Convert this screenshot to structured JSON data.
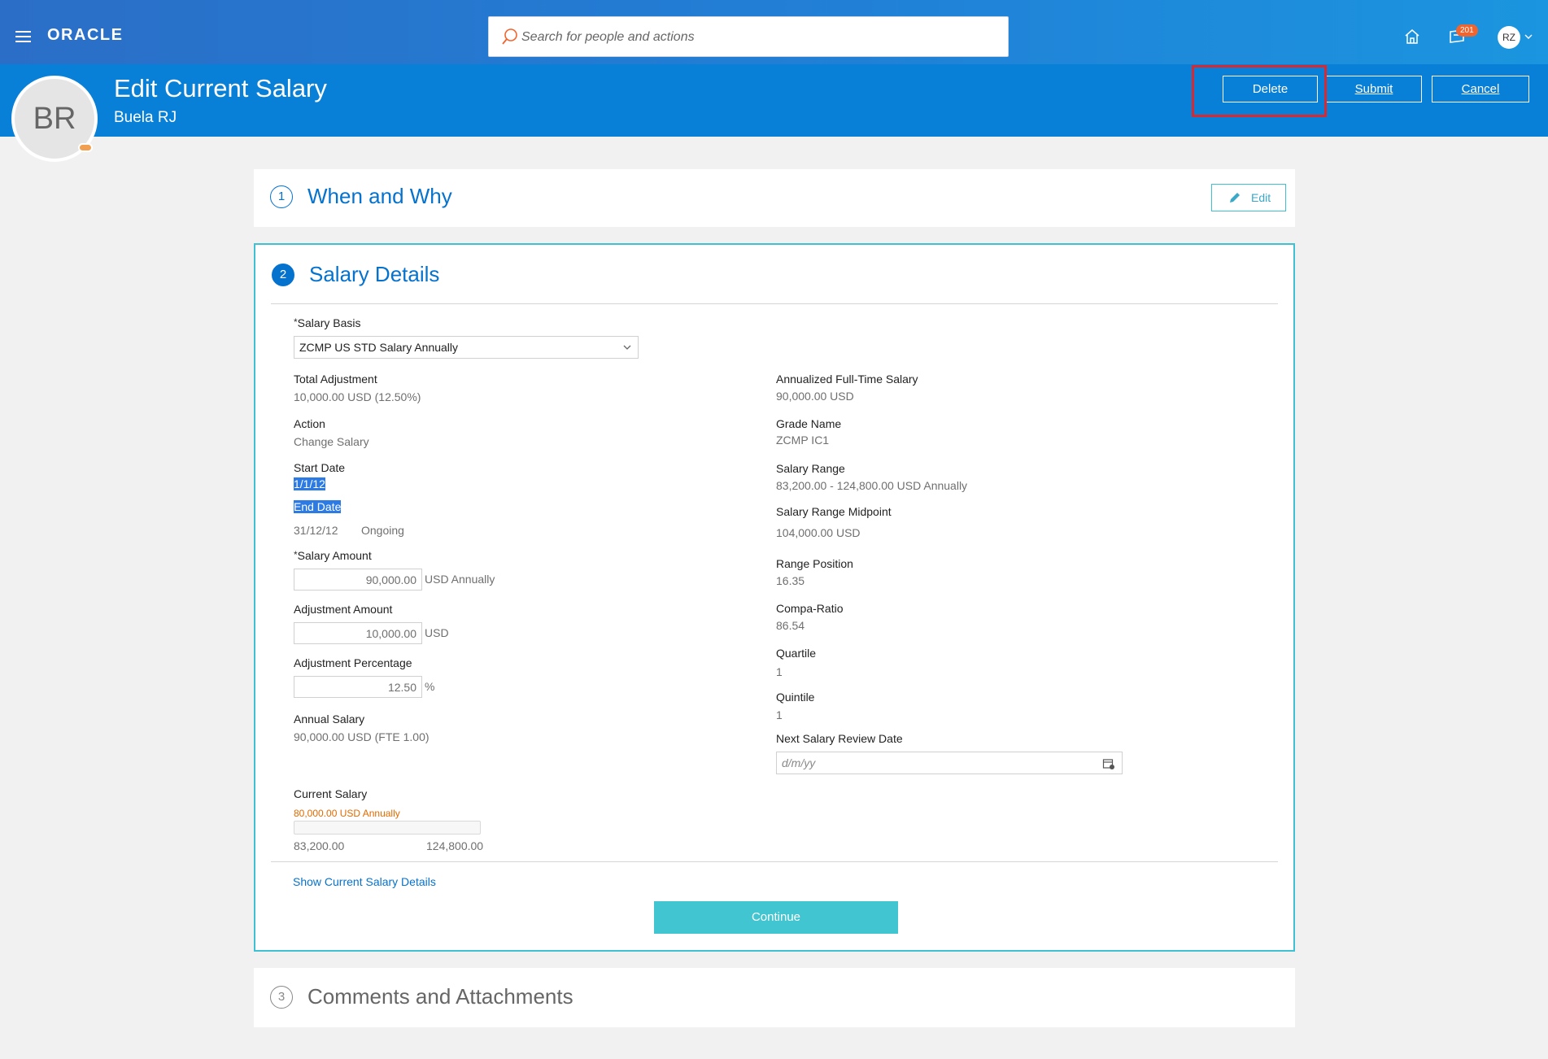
{
  "topbar": {
    "logo": "ORACLE",
    "search_placeholder": "Search for people and actions",
    "notification_count": "201",
    "user_initials": "RZ"
  },
  "header": {
    "avatar_initials": "BR",
    "title": "Edit Current Salary",
    "person_name": "Buela RJ",
    "buttons": {
      "delete": "Delete",
      "submit": "Submit",
      "cancel": "Cancel"
    }
  },
  "step1": {
    "number": "1",
    "title": "When and Why",
    "edit_label": "Edit"
  },
  "step2": {
    "number": "2",
    "title": "Salary Details",
    "left": {
      "salary_basis_label": "Salary Basis",
      "salary_basis_value": "ZCMP US STD Salary Annually",
      "total_adjustment_label": "Total Adjustment",
      "total_adjustment_value": "10,000.00 USD (12.50%)",
      "action_label": "Action",
      "action_value": "Change Salary",
      "start_date_label": "Start Date",
      "start_date_value": "1/1/12",
      "end_date_label": "End Date",
      "end_date_value": "31/12/12",
      "end_date_status": "Ongoing",
      "salary_amount_label": "Salary Amount",
      "salary_amount_value": "90,000.00",
      "salary_amount_unit": "USD Annually",
      "adjustment_amount_label": "Adjustment Amount",
      "adjustment_amount_value": "10,000.00",
      "adjustment_amount_unit": "USD",
      "adjustment_percentage_label": "Adjustment Percentage",
      "adjustment_percentage_value": "12.50",
      "adjustment_percentage_unit": "%",
      "annual_salary_label": "Annual Salary",
      "annual_salary_value": "90,000.00 USD (FTE 1.00)",
      "current_salary_label": "Current Salary",
      "current_salary_value": "80,000.00 USD Annually",
      "range_min": "83,200.00",
      "range_max": "124,800.00"
    },
    "right": {
      "annualized_label": "Annualized Full-Time Salary",
      "annualized_value": "90,000.00 USD",
      "grade_name_label": "Grade Name",
      "grade_name_value": "ZCMP IC1",
      "salary_range_label": "Salary Range",
      "salary_range_value": "83,200.00 - 124,800.00 USD Annually",
      "midpoint_label": "Salary Range Midpoint",
      "midpoint_value": "104,000.00 USD",
      "range_position_label": "Range Position",
      "range_position_value": "16.35",
      "compa_ratio_label": "Compa-Ratio",
      "compa_ratio_value": "86.54",
      "quartile_label": "Quartile",
      "quartile_value": "1",
      "quintile_label": "Quintile",
      "quintile_value": "1",
      "next_review_label": "Next Salary Review Date",
      "next_review_placeholder": "d/m/yy"
    },
    "show_details_link": "Show Current Salary Details",
    "continue_label": "Continue"
  },
  "step3": {
    "number": "3",
    "title": "Comments and Attachments"
  },
  "colors": {
    "header_blue": "#0880d7",
    "accent_teal": "#41c5d1",
    "link_blue": "#0572ce",
    "highlight_red": "#d9282f"
  }
}
